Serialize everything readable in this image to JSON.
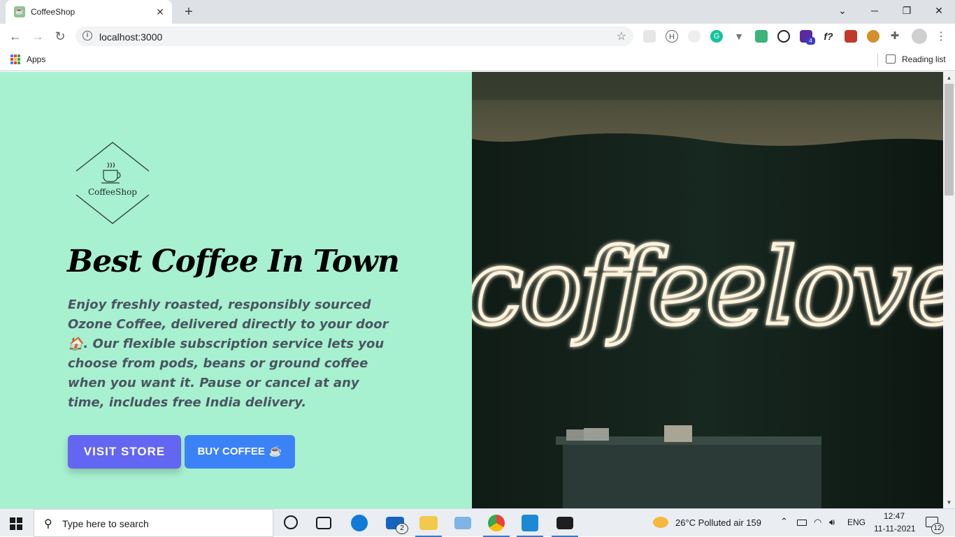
{
  "browser": {
    "tab_title": "CoffeeShop",
    "tab_close": "✕",
    "new_tab": "+",
    "win_chevron": "⌄",
    "win_minimize": "─",
    "win_restore": "❐",
    "win_close": "✕",
    "back": "←",
    "forward": "→",
    "reload": "↻",
    "url": "localhost:3000",
    "star": "☆",
    "ext_badge": "4",
    "ext_f": "f?",
    "menu": "⋮",
    "apps_label": "Apps",
    "reading_list": "Reading list"
  },
  "hero": {
    "logo_text": "CoffeeShop",
    "title": "Best Coffee In Town",
    "description": "Enjoy freshly roasted, responsibly sourced Ozone Coffee, delivered directly to your door🏠. Our flexible subscription service lets you choose from pods, beans or ground coffee when you want it. Pause or cancel at any time, includes free India delivery.",
    "visit_label": "VISIT STORE",
    "buy_label": "BUY COFFEE",
    "buy_emoji": "☕",
    "neon_text": "coffeelover"
  },
  "taskbar": {
    "search_placeholder": "Type here to search",
    "mail_badge": "2",
    "weather": "26°C  Polluted air 159",
    "lang": "ENG",
    "time": "12:47",
    "date": "11-11-2021",
    "notif_count": "12"
  },
  "colors": {
    "hero_bg": "#a7f0d0",
    "visit_btn": "#6366f1",
    "buy_btn": "#3b82f6"
  }
}
